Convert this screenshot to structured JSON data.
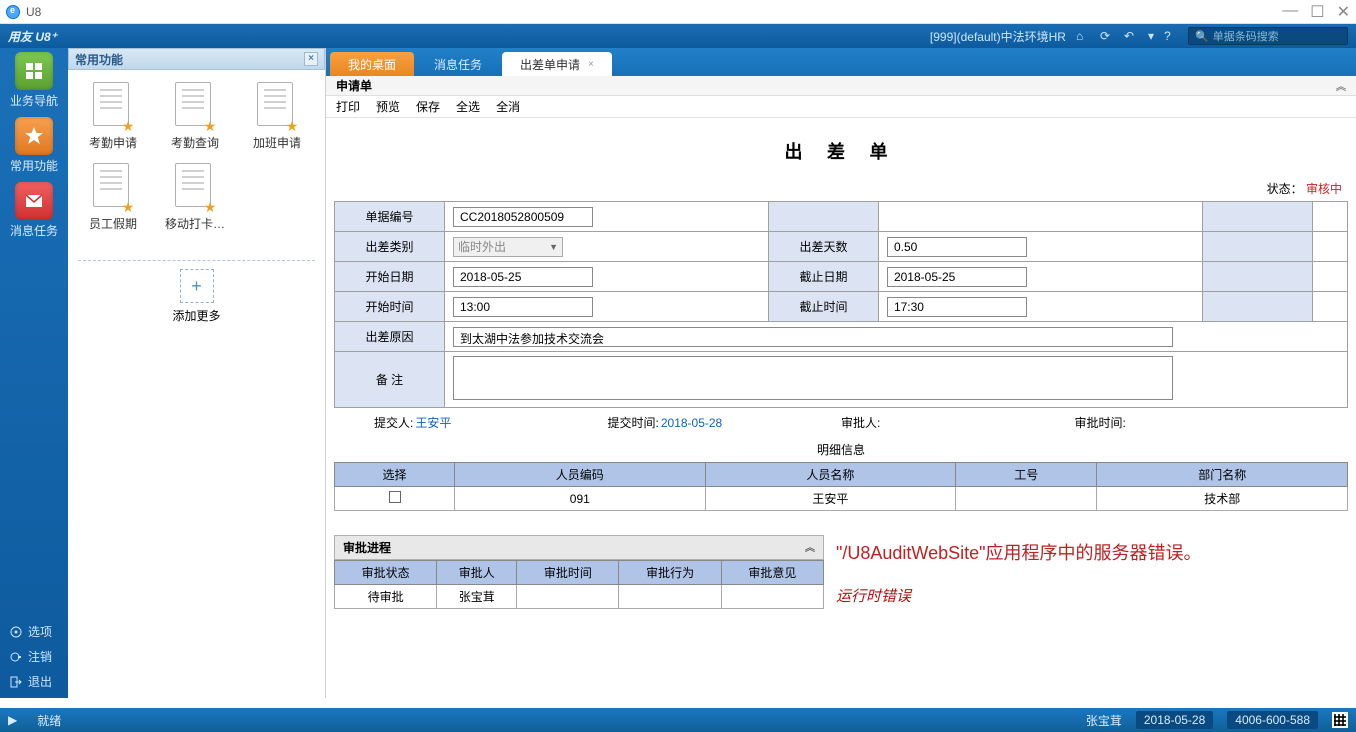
{
  "window": {
    "title": "U8"
  },
  "header": {
    "logo": "用友 U8⁺",
    "org": "[999](default)中法环境HR",
    "search_placeholder": "单据条码搜索"
  },
  "leftrail": {
    "items": [
      {
        "id": "biznav",
        "label": "业务导航"
      },
      {
        "id": "favfunc",
        "label": "常用功能"
      },
      {
        "id": "msgtask",
        "label": "消息任务"
      }
    ],
    "bottom": [
      {
        "id": "options",
        "label": "选项"
      },
      {
        "id": "logout",
        "label": "注销"
      },
      {
        "id": "exit",
        "label": "退出"
      }
    ]
  },
  "funcpanel": {
    "title": "常用功能",
    "items": [
      {
        "label": "考勤申请"
      },
      {
        "label": "考勤查询"
      },
      {
        "label": "加班申请"
      },
      {
        "label": "员工假期"
      },
      {
        "label": "移动打卡…"
      }
    ],
    "addmore": "添加更多"
  },
  "tabs": {
    "t0": "我的桌面",
    "t1": "消息任务",
    "t2": "出差单申请"
  },
  "subform": {
    "title": "申请单",
    "toolbar": {
      "print": "打印",
      "preview": "预览",
      "save": "保存",
      "selectall": "全选",
      "deselectall": "全消"
    }
  },
  "form": {
    "title": "出 差 单",
    "status_label": "状态：",
    "status_value": "审核中",
    "labels": {
      "docno": "单据编号",
      "triptype": "出差类别",
      "days": "出差天数",
      "startdate": "开始日期",
      "enddate": "截止日期",
      "starttime": "开始时间",
      "endtime": "截止时间",
      "reason": "出差原因",
      "remark": "备  注"
    },
    "values": {
      "docno": "CC2018052800509",
      "triptype": "临时外出",
      "days": "0.50",
      "startdate": "2018-05-25",
      "enddate": "2018-05-25",
      "starttime": "13:00",
      "endtime": "17:30",
      "reason": "到太湖中法参加技术交流会",
      "remark": ""
    },
    "meta": {
      "submitter_label": "提交人:",
      "submitter": "王安平",
      "submittime_label": "提交时间:",
      "submittime": "2018-05-28",
      "approver_label": "审批人:",
      "approver": "",
      "approvetime_label": "审批时间:",
      "approvetime": ""
    }
  },
  "detail": {
    "title": "明细信息",
    "headers": {
      "select": "选择",
      "empcode": "人员编码",
      "empname": "人员名称",
      "jobno": "工号",
      "dept": "部门名称"
    },
    "row": {
      "empcode": "091",
      "empname": "王安平",
      "jobno": "",
      "dept": "技术部"
    }
  },
  "approval": {
    "title": "审批进程",
    "headers": {
      "state": "审批状态",
      "person": "审批人",
      "time": "审批时间",
      "action": "审批行为",
      "comment": "审批意见"
    },
    "row": {
      "state": "待审批",
      "person": "张宝茸",
      "time": "",
      "action": "",
      "comment": ""
    }
  },
  "error": {
    "line1": "\"/U8AuditWebSite\"应用程序中的服务器错误。",
    "line2": "运行时错误"
  },
  "statusbar": {
    "ready": "就绪",
    "user": "张宝茸",
    "date": "2018-05-28",
    "phone": "4006-600-588"
  }
}
